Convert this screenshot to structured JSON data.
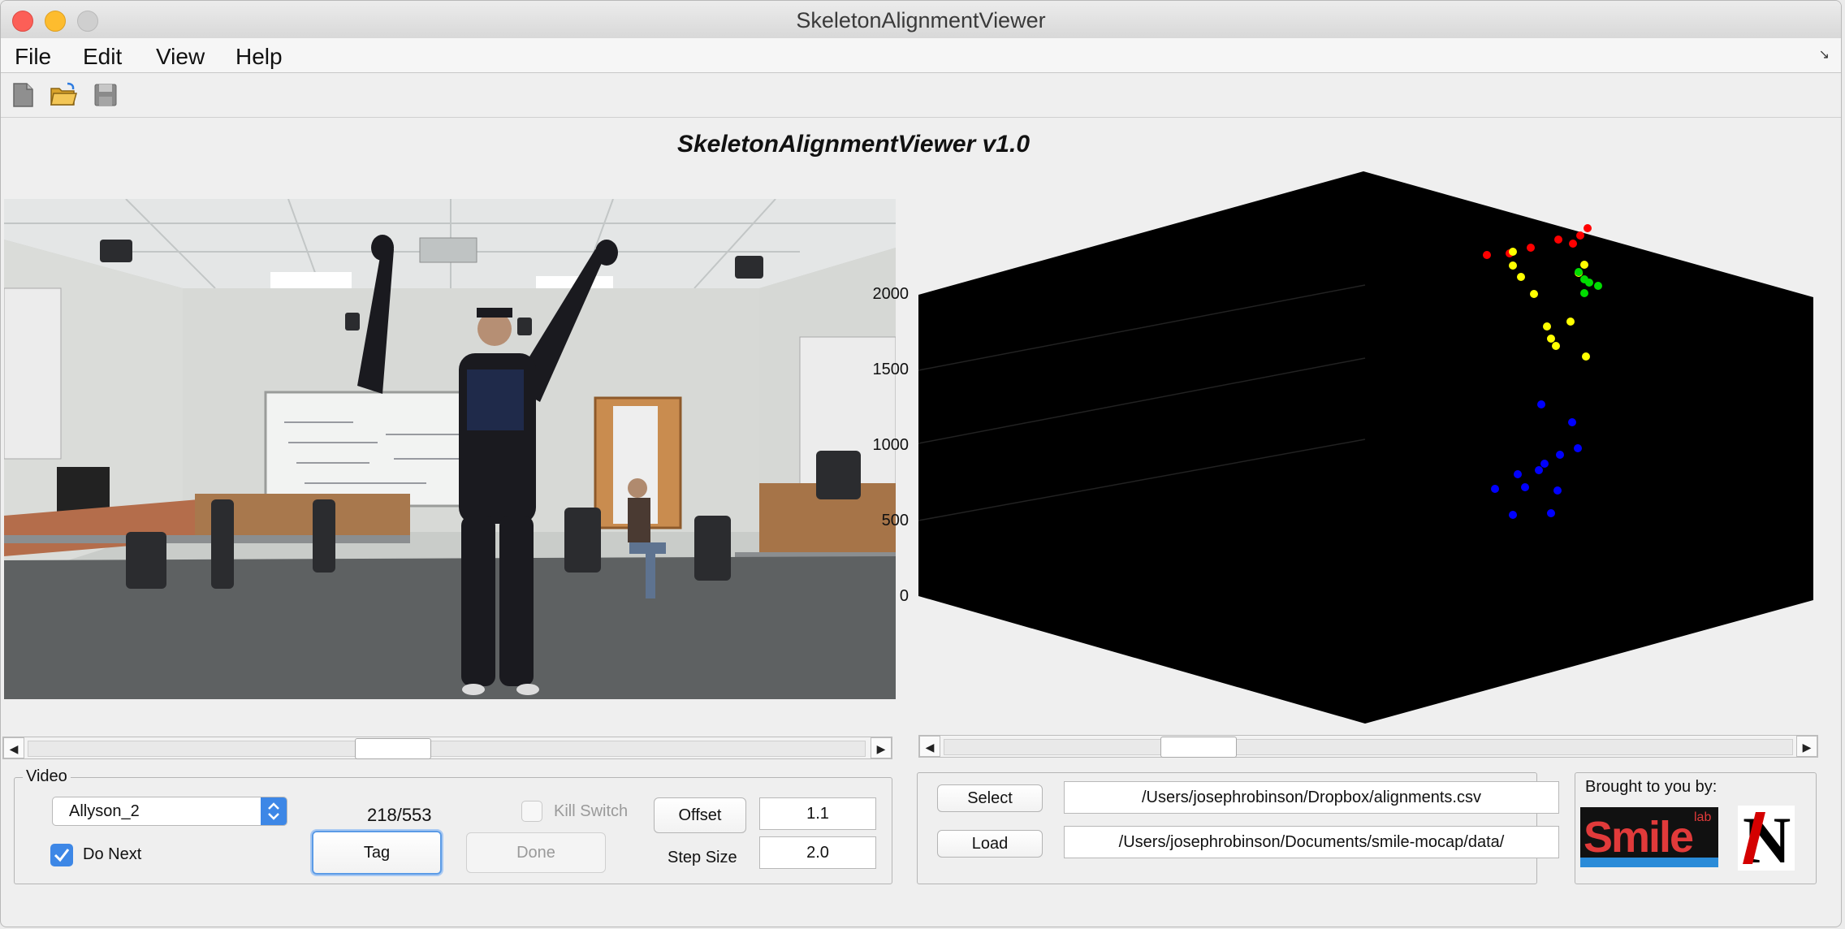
{
  "window": {
    "title": "SkeletonAlignmentViewer"
  },
  "menu": [
    "File",
    "Edit",
    "View",
    "Help"
  ],
  "toolbar": {
    "icons": [
      "new-file-icon",
      "open-folder-icon",
      "save-icon"
    ]
  },
  "app_title": "SkeletonAlignmentViewer v1.0",
  "plot": {
    "z_ticks": [
      "2000",
      "1500",
      "1000",
      "500",
      "0"
    ],
    "background": "#000000",
    "joint_colors": {
      "red": "#ff0000",
      "yellow": "#ffff00",
      "green": "#00dd00",
      "blue": "#0000ff"
    }
  },
  "video_scroll": {
    "position": 0.43
  },
  "plot_scroll": {
    "position": 0.28
  },
  "video_panel": {
    "title": "Video",
    "subject_select": "Allyson_2",
    "frame_counter": "218/553",
    "kill_switch_label": "Kill Switch",
    "kill_switch_checked": false,
    "offset_button": "Offset",
    "offset_value": "1.1",
    "do_next_label": "Do Next",
    "do_next_checked": true,
    "tag_button": "Tag",
    "done_button": "Done",
    "step_size_label": "Step Size",
    "step_size_value": "2.0"
  },
  "files_panel": {
    "select_button": "Select",
    "select_path": "/Users/josephrobinson/Dropbox/alignments.csv",
    "load_button": "Load",
    "load_path": "/Users/josephrobinson/Documents/smile-mocap/data/"
  },
  "credits": {
    "label": "Brought to you by:",
    "logo1": "Smile",
    "logo1_sup": "lab",
    "logo2": "N"
  }
}
